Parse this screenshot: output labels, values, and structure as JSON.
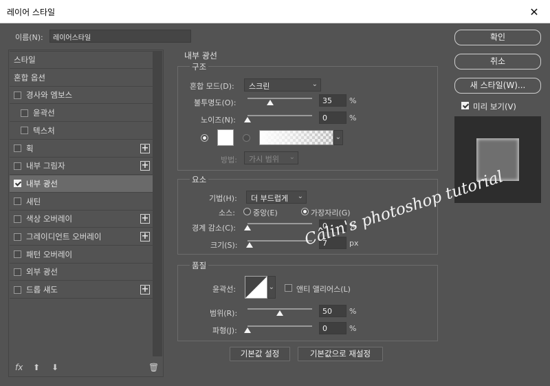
{
  "window": {
    "title": "레이어 스타일"
  },
  "name": {
    "label": "이름(N):",
    "value": "레이어스타일"
  },
  "list": [
    {
      "label": "스타일",
      "checkbox": false,
      "checked": false,
      "plus": false,
      "indent": false,
      "active": false
    },
    {
      "label": "혼합 옵션",
      "checkbox": false,
      "checked": false,
      "plus": false,
      "indent": false,
      "active": false
    },
    {
      "label": "경사와 엠보스",
      "checkbox": true,
      "checked": false,
      "plus": false,
      "indent": false,
      "active": false
    },
    {
      "label": "윤곽선",
      "checkbox": true,
      "checked": false,
      "plus": false,
      "indent": true,
      "active": false
    },
    {
      "label": "텍스처",
      "checkbox": true,
      "checked": false,
      "plus": false,
      "indent": true,
      "active": false
    },
    {
      "label": "획",
      "checkbox": true,
      "checked": false,
      "plus": true,
      "indent": false,
      "active": false
    },
    {
      "label": "내부 그림자",
      "checkbox": true,
      "checked": false,
      "plus": true,
      "indent": false,
      "active": false
    },
    {
      "label": "내부 광선",
      "checkbox": true,
      "checked": true,
      "plus": false,
      "indent": false,
      "active": true
    },
    {
      "label": "새틴",
      "checkbox": true,
      "checked": false,
      "plus": false,
      "indent": false,
      "active": false
    },
    {
      "label": "색상 오버레이",
      "checkbox": true,
      "checked": false,
      "plus": true,
      "indent": false,
      "active": false
    },
    {
      "label": "그레이디언트 오버레이",
      "checkbox": true,
      "checked": false,
      "plus": true,
      "indent": false,
      "active": false
    },
    {
      "label": "패턴 오버레이",
      "checkbox": true,
      "checked": false,
      "plus": false,
      "indent": false,
      "active": false
    },
    {
      "label": "외부 광선",
      "checkbox": true,
      "checked": false,
      "plus": false,
      "indent": false,
      "active": false
    },
    {
      "label": "드롭 섀도",
      "checkbox": true,
      "checked": false,
      "plus": true,
      "indent": false,
      "active": false
    }
  ],
  "bottom_icons": {
    "fx": "fx",
    "up": "⬆",
    "down": "⬇",
    "trash": "🗑"
  },
  "panel": {
    "title": "내부 광선"
  },
  "structure": {
    "title": "구조",
    "blend_label": "혼합 모드(D):",
    "blend_value": "스크린",
    "opacity_label": "불투명도(O):",
    "opacity_value": "35",
    "opacity_unit": "%",
    "opacity_level": 0.35,
    "noise_label": "노이즈(N):",
    "noise_value": "0",
    "noise_unit": "%",
    "noise_level": 0,
    "method_label": "방법:",
    "method_value": "가시 범위"
  },
  "elements": {
    "title": "요소",
    "technique_label": "기법(H):",
    "technique_value": "더 부드럽게",
    "source_label": "소스:",
    "source_center": "중앙(E)",
    "source_edge": "가장자리(G)",
    "choke_label": "경계 감소(C):",
    "choke_value": "0",
    "choke_unit": "%",
    "choke_level": 0,
    "size_label": "크기(S):",
    "size_value": "7",
    "size_unit": "px",
    "size_level": 0.03
  },
  "quality": {
    "title": "품질",
    "contour_label": "윤곽선:",
    "antialias_label": "앤티 앨리어스(L)",
    "range_label": "범위(R):",
    "range_value": "50",
    "range_unit": "%",
    "range_level": 0.5,
    "jitter_label": "파형(J):",
    "jitter_value": "0",
    "jitter_unit": "%",
    "jitter_level": 0
  },
  "buttons": {
    "ok": "확인",
    "cancel": "취소",
    "new_style": "새 스타일(W)...",
    "preview": "미리 보기(V)",
    "make_default": "기본값 설정",
    "reset_default": "기본값으로 재설정"
  },
  "watermark": "Câlin's photoshop tutorial"
}
